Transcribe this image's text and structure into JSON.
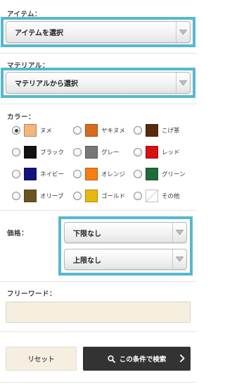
{
  "item": {
    "label": "アイテム：",
    "selected": "アイテムを選択"
  },
  "material": {
    "label": "マテリアル：",
    "selected": "マテリアルから選択"
  },
  "color": {
    "label": "カラー：",
    "options": [
      {
        "label": "ヌメ",
        "hex": "#f3b57c",
        "checked": true
      },
      {
        "label": "ヤキヌメ",
        "hex": "#d9691e",
        "checked": false
      },
      {
        "label": "こげ茶",
        "hex": "#5a2a0e",
        "checked": false
      },
      {
        "label": "ブラック",
        "hex": "#111111",
        "checked": false
      },
      {
        "label": "グレー",
        "hex": "#777777",
        "checked": false
      },
      {
        "label": "レッド",
        "hex": "#d41212",
        "checked": false
      },
      {
        "label": "ネイビー",
        "hex": "#15127e",
        "checked": false
      },
      {
        "label": "オレンジ",
        "hex": "#f57f12",
        "checked": false
      },
      {
        "label": "グリーン",
        "hex": "#1e6b3a",
        "checked": false
      },
      {
        "label": "オリーブ",
        "hex": "#6b5420",
        "checked": false
      },
      {
        "label": "ゴールド",
        "hex": "#e8b80c",
        "checked": false
      },
      {
        "label": "その他",
        "hex": "#ffffff",
        "checked": false
      }
    ]
  },
  "price": {
    "label": "価格：",
    "min_selected": "下限なし",
    "max_selected": "上限なし"
  },
  "freeword": {
    "label": "フリーワード：",
    "value": ""
  },
  "buttons": {
    "reset": "リセット",
    "search": "この条件で検索"
  },
  "colors": {
    "highlight": "#57b8cf",
    "field_bg": "#f6efe0",
    "search_bg": "#333333"
  }
}
